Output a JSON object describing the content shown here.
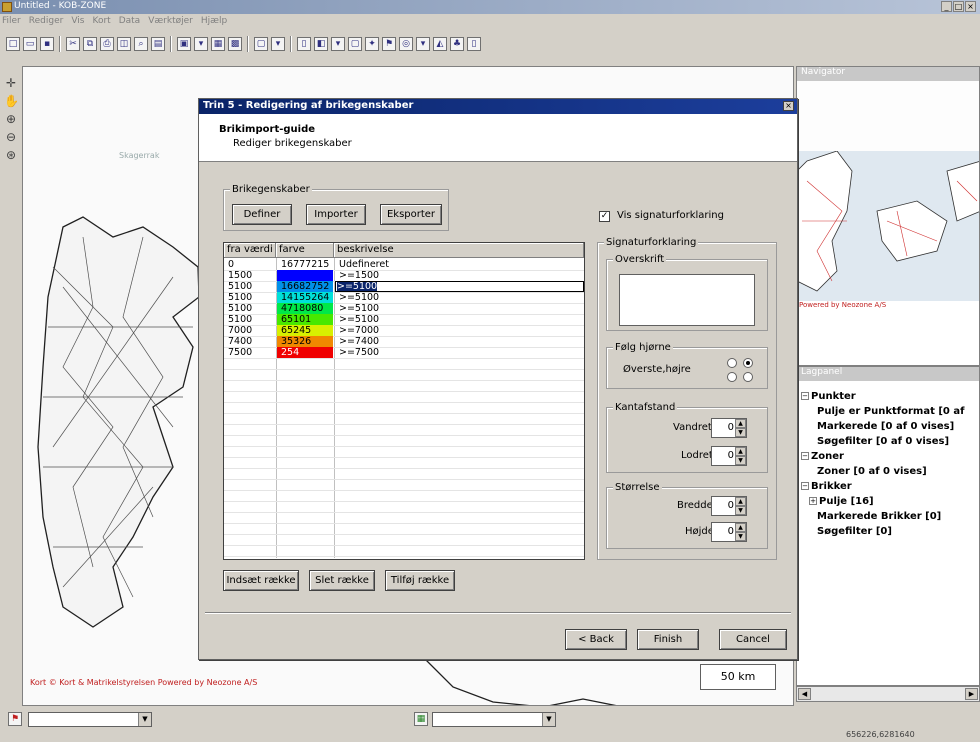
{
  "window": {
    "title": "Untitled - KOB-ZONE",
    "min": "_",
    "max": "□",
    "close": "×"
  },
  "menu": [
    "Filer",
    "Rediger",
    "Vis",
    "Kort",
    "Data",
    "Værktøjer",
    "Hjælp"
  ],
  "map": {
    "sea_label": "Skagerrak",
    "credit": "Kort © Kort & Matrikelstyrelsen Powered by Neozone A/S",
    "scale": "50 km"
  },
  "navigator": {
    "title": "Navigator",
    "credit": "Powered by Neozone A/S"
  },
  "tree": {
    "title": "Lagpanel",
    "items": [
      {
        "label": "Punkter",
        "level": 0,
        "toggle": "−"
      },
      {
        "label": "Pulje er Punktformat [0 af",
        "level": 1
      },
      {
        "label": "Markerede [0 af 0 vises]",
        "level": 1
      },
      {
        "label": "Søgefilter [0 af 0 vises]",
        "level": 1
      },
      {
        "label": "Zoner",
        "level": 0,
        "toggle": "−"
      },
      {
        "label": "Zoner [0 af 0 vises]",
        "level": 1
      },
      {
        "label": "Brikker",
        "level": 0,
        "toggle": "−"
      },
      {
        "label": "Pulje [16]",
        "level": 1,
        "toggle": "+"
      },
      {
        "label": "Markerede Brikker [0]",
        "level": 1
      },
      {
        "label": "Søgefilter [0]",
        "level": 1
      }
    ]
  },
  "status": {
    "coords": "656226,6281640"
  },
  "dialog": {
    "title": "Trin 5 - Redigering af brikegenskaber",
    "close": "×",
    "header_title": "Brikimport-guide",
    "header_subtitle": "Rediger brikegenskaber",
    "group_label": "Brikegenskaber",
    "btn_define": "Definer",
    "btn_import": "Importer",
    "btn_export": "Eksporter",
    "grid": {
      "columns": [
        "fra værdi",
        "farve",
        "beskrivelse"
      ],
      "rows": [
        {
          "from": "0",
          "color_value": "16777215",
          "color": "#ffffff",
          "text_color": "#000000",
          "desc": "Udefineret"
        },
        {
          "from": "1500",
          "color_value": "16711680",
          "color": "#0000ff",
          "text_color": "#0000ff",
          "desc": ">=1500"
        },
        {
          "from": "5100",
          "color_value": "16682752",
          "color": "#0090e8",
          "text_color": "#000000",
          "desc": ">=5100",
          "editing": true
        },
        {
          "from": "5100",
          "color_value": "14155264",
          "color": "#00e0d8",
          "text_color": "#000000",
          "desc": ">=5100"
        },
        {
          "from": "5100",
          "color_value": "4718080",
          "color": "#00e848",
          "text_color": "#000000",
          "desc": ">=5100"
        },
        {
          "from": "5100",
          "color_value": "65101",
          "color": "#48e800",
          "text_color": "#000000",
          "desc": ">=5100"
        },
        {
          "from": "7000",
          "color_value": "65245",
          "color": "#d8f000",
          "text_color": "#000000",
          "desc": ">=7000"
        },
        {
          "from": "7400",
          "color_value": "35326",
          "color": "#f08800",
          "text_color": "#000000",
          "desc": ">=7400"
        },
        {
          "from": "7500",
          "color_value": "254",
          "color": "#f00000",
          "text_color": "#ffffff",
          "desc": ">=7500"
        }
      ]
    },
    "btn_insert_row": "Indsæt række",
    "btn_delete_row": "Slet række",
    "btn_add_row": "Tilføj række",
    "show_legend_label": "Vis signaturforklaring",
    "show_legend_checked": "✓",
    "legend_group": "Signaturforklaring",
    "heading_group": "Overskrift",
    "corner_group": "Følg hjørne",
    "corner_value": "Øverste,højre",
    "spacing_group": "Kantafstand",
    "horizontal_label": "Vandret",
    "horizontal_value": "0",
    "vertical_label": "Lodret",
    "vertical_value": "0",
    "size_group": "Størrelse",
    "width_label": "Bredde",
    "width_value": "0",
    "height_label": "Højde",
    "height_value": "0",
    "btn_back": "< Back",
    "btn_finish": "Finish",
    "btn_cancel": "Cancel"
  }
}
